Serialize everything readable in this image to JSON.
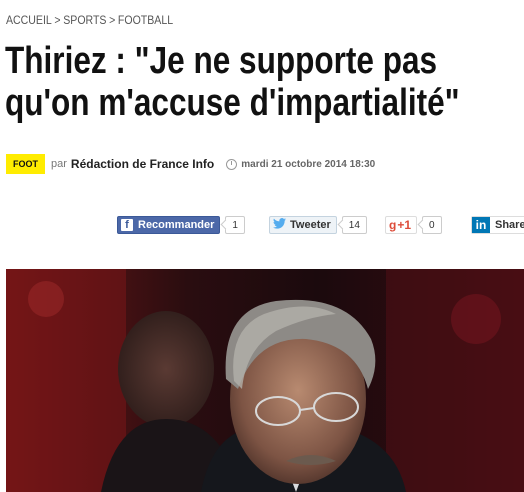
{
  "breadcrumb": {
    "items": [
      "ACCUEIL",
      "SPORTS",
      "FOOTBALL"
    ],
    "separator": ">"
  },
  "article": {
    "title": "Thiriez : \"Je ne supporte pas qu'on m'accuse d'impartialité\"",
    "category_badge": "FOOT",
    "byline_prefix": "par",
    "author": "Rédaction de France Info",
    "date": "mardi 21 octobre 2014 18:30"
  },
  "share": {
    "facebook": {
      "label": "Recommander",
      "count": "1",
      "icon": "facebook-icon"
    },
    "twitter": {
      "label": "Tweeter",
      "count": "14",
      "icon": "twitter-icon"
    },
    "googleplus": {
      "label": "+1",
      "count": "0",
      "icon": "google-plus-icon"
    },
    "linkedin": {
      "label": "Share",
      "icon": "linkedin-icon"
    }
  },
  "colors": {
    "badge": "#ffec00",
    "facebook": "#4c68a8",
    "twitter": "#55acee",
    "googleplus": "#dd4b39",
    "linkedin": "#0077b5"
  }
}
